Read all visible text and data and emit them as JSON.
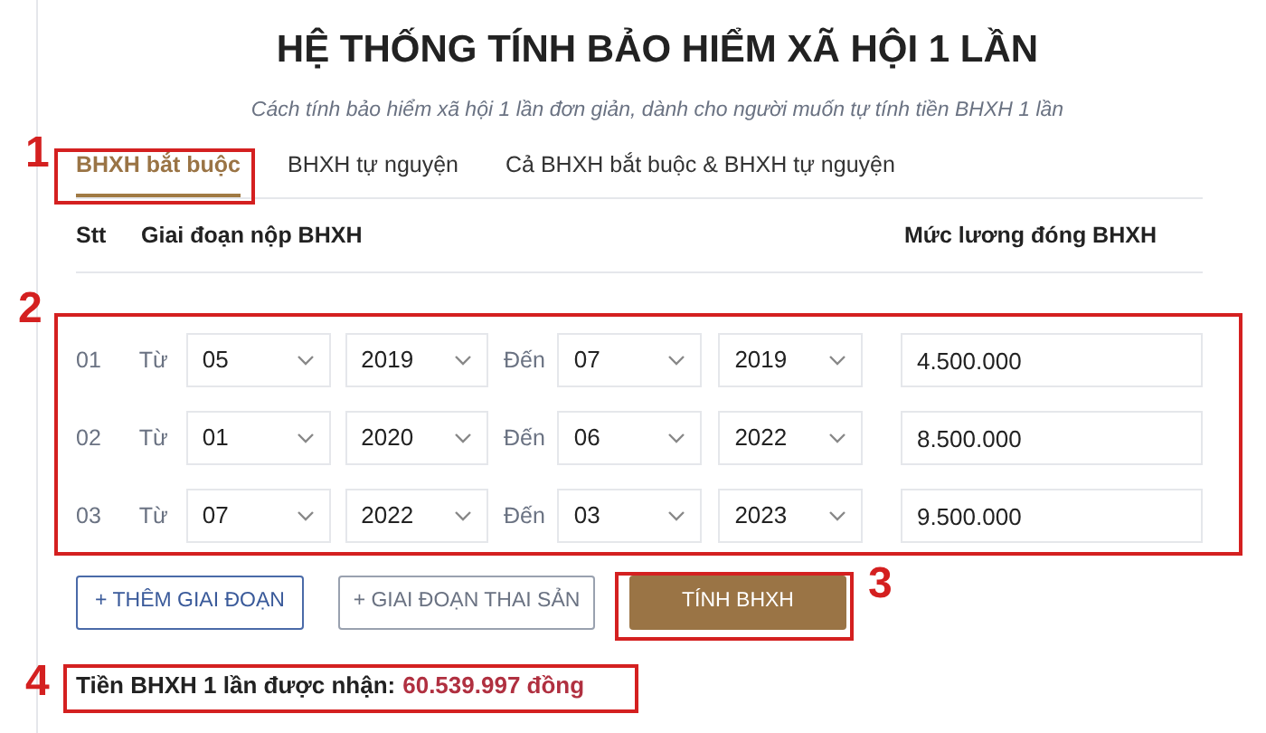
{
  "title": "HỆ THỐNG TÍNH BẢO HIỂM XÃ HỘI 1 LẦN",
  "subtitle": "Cách tính bảo hiểm xã hội 1 lần đơn giản, dành cho người muốn tự tính tiền BHXH 1 lần",
  "tabs": [
    {
      "label": "BHXH bắt buộc",
      "selected": true
    },
    {
      "label": "BHXH tự nguyện",
      "selected": false
    },
    {
      "label": "Cả BHXH bắt buộc & BHXH tự nguyện",
      "selected": false
    }
  ],
  "columns": [
    "Stt",
    "Giai đoạn nộp BHXH",
    "Mức lương đóng BHXH"
  ],
  "rows": [
    {
      "stt": "01",
      "from_label": "Từ",
      "from_month": "05",
      "from_year": "2019",
      "to_label": "Đến",
      "to_month": "07",
      "to_year": "2019",
      "salary": "4.500.000"
    },
    {
      "stt": "02",
      "from_label": "Từ",
      "from_month": "01",
      "from_year": "2020",
      "to_label": "Đến",
      "to_month": "06",
      "to_year": "2022",
      "salary": "8.500.000"
    },
    {
      "stt": "03",
      "from_label": "Từ",
      "from_month": "07",
      "from_year": "2022",
      "to_label": "Đến",
      "to_month": "03",
      "to_year": "2023",
      "salary": "9.500.000"
    }
  ],
  "buttons": [
    {
      "label": "+ THÊM GIAI ĐOẠN",
      "kind": "outline-blue"
    },
    {
      "label": "+ GIAI ĐOẠN THAI SẢN",
      "kind": "outline-grey"
    },
    {
      "label": "TÍNH BHXH",
      "kind": "primary"
    }
  ],
  "result": {
    "label": "Tiền BHXH 1 lần được nhận:",
    "value": "60.539.997 đồng"
  },
  "annotations": [
    {
      "number": "1"
    },
    {
      "number": "2"
    },
    {
      "number": "3"
    },
    {
      "number": "4"
    }
  ]
}
